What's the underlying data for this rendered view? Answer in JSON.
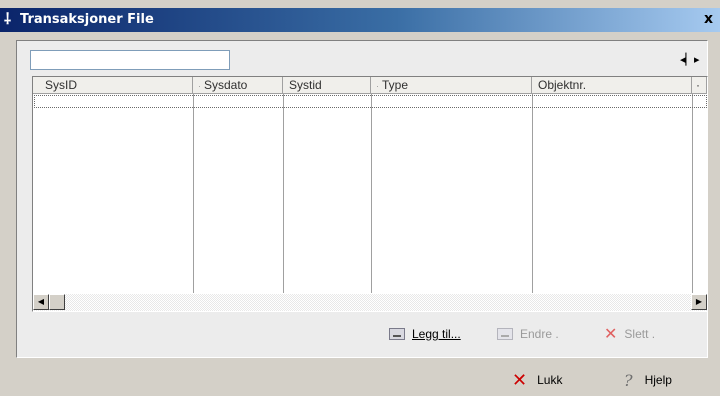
{
  "window": {
    "title": "Transaksjoner File",
    "close_glyph": "x"
  },
  "search": {
    "value": ""
  },
  "grid": {
    "columns": [
      {
        "label": "SysID",
        "tick": ""
      },
      {
        "label": "Sysdato",
        "tick": "·"
      },
      {
        "label": "Systid",
        "tick": ""
      },
      {
        "label": "Type",
        "tick": "·"
      },
      {
        "label": "Objektnr.",
        "tick": ""
      },
      {
        "label": "·",
        "tick": ""
      }
    ],
    "rows": []
  },
  "actions": {
    "add": "Legg til...",
    "edit": "Endre .",
    "delete": "Slett ."
  },
  "footer": {
    "close": "Lukk",
    "help": "Hjelp"
  },
  "icons": [
    "app-icon",
    "splitter-icon",
    "add-icon",
    "edit-icon",
    "delete-icon",
    "close-icon",
    "help-icon"
  ]
}
